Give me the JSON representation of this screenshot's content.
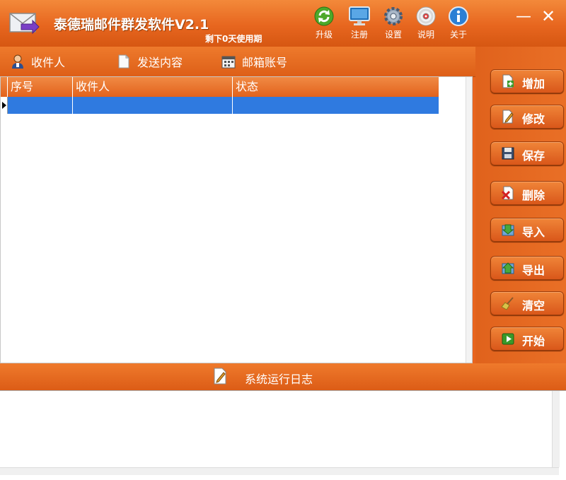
{
  "window": {
    "title": "泰德瑞邮件群发软件V2.1",
    "remaining": "剩下0天使用期",
    "min_symbol": "—",
    "close_symbol": "✕"
  },
  "toolbar": [
    {
      "label": "升级",
      "icon": "refresh-icon"
    },
    {
      "label": "注册",
      "icon": "monitor-icon"
    },
    {
      "label": "设置",
      "icon": "gear-icon"
    },
    {
      "label": "说明",
      "icon": "cd-icon"
    },
    {
      "label": "关于",
      "icon": "info-icon"
    }
  ],
  "tabs": [
    {
      "label": "收件人",
      "icon": "user-icon"
    },
    {
      "label": "发送内容",
      "icon": "document-icon"
    },
    {
      "label": "邮箱账号",
      "icon": "calendar-icon"
    }
  ],
  "grid": {
    "columns": [
      "序号",
      "收件人",
      "状态"
    ],
    "rows": [
      [
        "",
        "",
        ""
      ]
    ]
  },
  "actions": [
    {
      "label": "增加",
      "icon": "add-document-icon"
    },
    {
      "label": "修改",
      "icon": "edit-document-icon"
    },
    {
      "label": "保存",
      "icon": "floppy-icon"
    },
    {
      "label": "删除",
      "icon": "delete-icon"
    },
    {
      "label": "导入",
      "icon": "import-icon"
    },
    {
      "label": "导出",
      "icon": "export-icon"
    },
    {
      "label": "清空",
      "icon": "broom-icon"
    },
    {
      "label": "开始",
      "icon": "start-icon"
    }
  ],
  "log": {
    "title": "系统运行日志",
    "content": ""
  },
  "colors": {
    "accent": "#e7661f",
    "selection": "#2f7ae0"
  }
}
